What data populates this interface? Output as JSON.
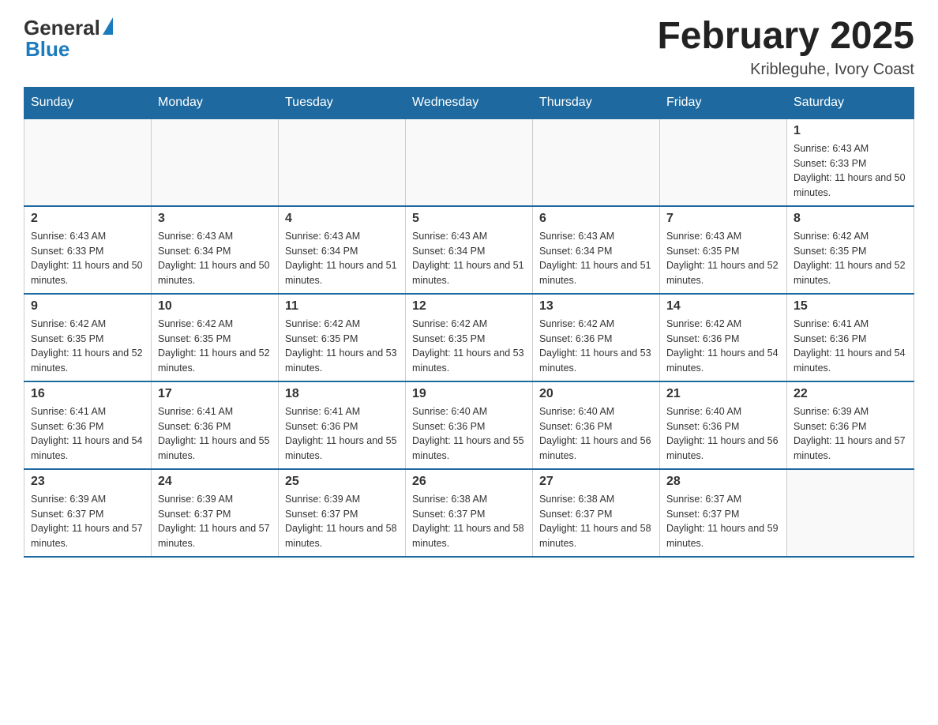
{
  "header": {
    "logo_general": "General",
    "logo_blue": "Blue",
    "title": "February 2025",
    "location": "Kribleguhe, Ivory Coast"
  },
  "weekdays": [
    "Sunday",
    "Monday",
    "Tuesday",
    "Wednesday",
    "Thursday",
    "Friday",
    "Saturday"
  ],
  "weeks": [
    [
      {
        "day": "",
        "info": ""
      },
      {
        "day": "",
        "info": ""
      },
      {
        "day": "",
        "info": ""
      },
      {
        "day": "",
        "info": ""
      },
      {
        "day": "",
        "info": ""
      },
      {
        "day": "",
        "info": ""
      },
      {
        "day": "1",
        "info": "Sunrise: 6:43 AM\nSunset: 6:33 PM\nDaylight: 11 hours and 50 minutes."
      }
    ],
    [
      {
        "day": "2",
        "info": "Sunrise: 6:43 AM\nSunset: 6:33 PM\nDaylight: 11 hours and 50 minutes."
      },
      {
        "day": "3",
        "info": "Sunrise: 6:43 AM\nSunset: 6:34 PM\nDaylight: 11 hours and 50 minutes."
      },
      {
        "day": "4",
        "info": "Sunrise: 6:43 AM\nSunset: 6:34 PM\nDaylight: 11 hours and 51 minutes."
      },
      {
        "day": "5",
        "info": "Sunrise: 6:43 AM\nSunset: 6:34 PM\nDaylight: 11 hours and 51 minutes."
      },
      {
        "day": "6",
        "info": "Sunrise: 6:43 AM\nSunset: 6:34 PM\nDaylight: 11 hours and 51 minutes."
      },
      {
        "day": "7",
        "info": "Sunrise: 6:43 AM\nSunset: 6:35 PM\nDaylight: 11 hours and 52 minutes."
      },
      {
        "day": "8",
        "info": "Sunrise: 6:42 AM\nSunset: 6:35 PM\nDaylight: 11 hours and 52 minutes."
      }
    ],
    [
      {
        "day": "9",
        "info": "Sunrise: 6:42 AM\nSunset: 6:35 PM\nDaylight: 11 hours and 52 minutes."
      },
      {
        "day": "10",
        "info": "Sunrise: 6:42 AM\nSunset: 6:35 PM\nDaylight: 11 hours and 52 minutes."
      },
      {
        "day": "11",
        "info": "Sunrise: 6:42 AM\nSunset: 6:35 PM\nDaylight: 11 hours and 53 minutes."
      },
      {
        "day": "12",
        "info": "Sunrise: 6:42 AM\nSunset: 6:35 PM\nDaylight: 11 hours and 53 minutes."
      },
      {
        "day": "13",
        "info": "Sunrise: 6:42 AM\nSunset: 6:36 PM\nDaylight: 11 hours and 53 minutes."
      },
      {
        "day": "14",
        "info": "Sunrise: 6:42 AM\nSunset: 6:36 PM\nDaylight: 11 hours and 54 minutes."
      },
      {
        "day": "15",
        "info": "Sunrise: 6:41 AM\nSunset: 6:36 PM\nDaylight: 11 hours and 54 minutes."
      }
    ],
    [
      {
        "day": "16",
        "info": "Sunrise: 6:41 AM\nSunset: 6:36 PM\nDaylight: 11 hours and 54 minutes."
      },
      {
        "day": "17",
        "info": "Sunrise: 6:41 AM\nSunset: 6:36 PM\nDaylight: 11 hours and 55 minutes."
      },
      {
        "day": "18",
        "info": "Sunrise: 6:41 AM\nSunset: 6:36 PM\nDaylight: 11 hours and 55 minutes."
      },
      {
        "day": "19",
        "info": "Sunrise: 6:40 AM\nSunset: 6:36 PM\nDaylight: 11 hours and 55 minutes."
      },
      {
        "day": "20",
        "info": "Sunrise: 6:40 AM\nSunset: 6:36 PM\nDaylight: 11 hours and 56 minutes."
      },
      {
        "day": "21",
        "info": "Sunrise: 6:40 AM\nSunset: 6:36 PM\nDaylight: 11 hours and 56 minutes."
      },
      {
        "day": "22",
        "info": "Sunrise: 6:39 AM\nSunset: 6:36 PM\nDaylight: 11 hours and 57 minutes."
      }
    ],
    [
      {
        "day": "23",
        "info": "Sunrise: 6:39 AM\nSunset: 6:37 PM\nDaylight: 11 hours and 57 minutes."
      },
      {
        "day": "24",
        "info": "Sunrise: 6:39 AM\nSunset: 6:37 PM\nDaylight: 11 hours and 57 minutes."
      },
      {
        "day": "25",
        "info": "Sunrise: 6:39 AM\nSunset: 6:37 PM\nDaylight: 11 hours and 58 minutes."
      },
      {
        "day": "26",
        "info": "Sunrise: 6:38 AM\nSunset: 6:37 PM\nDaylight: 11 hours and 58 minutes."
      },
      {
        "day": "27",
        "info": "Sunrise: 6:38 AM\nSunset: 6:37 PM\nDaylight: 11 hours and 58 minutes."
      },
      {
        "day": "28",
        "info": "Sunrise: 6:37 AM\nSunset: 6:37 PM\nDaylight: 11 hours and 59 minutes."
      },
      {
        "day": "",
        "info": ""
      }
    ]
  ]
}
